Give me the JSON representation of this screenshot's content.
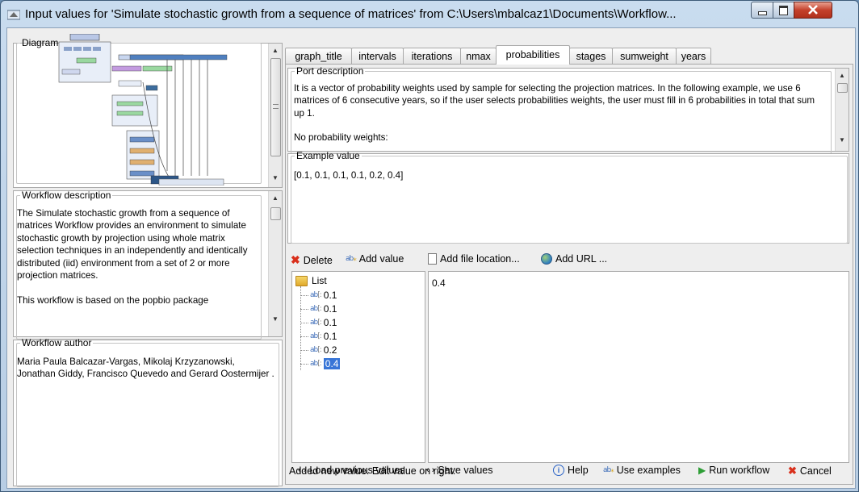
{
  "window": {
    "title": "Input values for 'Simulate stochastic growth from a sequence of matrices' from C:\\Users\\mbalcaz1\\Documents\\Workflow...",
    "icon": "taverna-icon"
  },
  "left": {
    "diagram_label": "Diagram",
    "workflow_description_label": "Workflow description",
    "workflow_description": "The Simulate stochastic growth from a sequence of matrices Workflow provides an environment to simulate stochastic growth by projection using whole matrix selection techniques in an independently and identically distributed (iid) environment from a set of 2 or more projection matrices.\n\nThis workflow is based on the popbio package",
    "workflow_author_label": "Workflow author",
    "workflow_author": "Maria Paula Balcazar-Vargas, Mikolaj Krzyzanowski, Jonathan Giddy, Francisco Quevedo and Gerard Oostermijer ."
  },
  "tabs": [
    {
      "label": "graph_title"
    },
    {
      "label": "intervals"
    },
    {
      "label": "iterations"
    },
    {
      "label": "nmax"
    },
    {
      "label": "probabilities",
      "active": true
    },
    {
      "label": "stages"
    },
    {
      "label": "sumweight"
    },
    {
      "label": "years"
    }
  ],
  "port": {
    "description_label": "Port description",
    "description": "It is a vector of probability weights used by sample for selecting the projection matrices. In the following example, we use 6 matrices of 6 consecutive years, so if the user selects probabilities weights, the user must fill in 6 probabilities in total that sum up 1.",
    "description_more": "No probability weights:",
    "example_label": "Example value",
    "example_value": "[0.1, 0.1, 0.1, 0.1, 0.2, 0.4]"
  },
  "toolbar": {
    "delete": "Delete",
    "add_value": "Add value",
    "add_file_location": "Add file location...",
    "add_url": "Add URL ..."
  },
  "tree": {
    "root": "List",
    "items": [
      "0.1",
      "0.1",
      "0.1",
      "0.1",
      "0.2",
      "0.4"
    ],
    "selected_index": 5
  },
  "editor": {
    "value": "0.4"
  },
  "status": "Added new value.  Edit value on right.",
  "bottom": {
    "load_previous": "Load previous values",
    "save_values": "Save values",
    "help": "Help",
    "use_examples": "Use examples",
    "run_workflow": "Run workflow",
    "cancel": "Cancel"
  },
  "colors": {
    "selection": "#3875d7",
    "delete_red": "#d9301c",
    "run_green": "#2e9e36",
    "help_blue": "#2a63c6"
  }
}
